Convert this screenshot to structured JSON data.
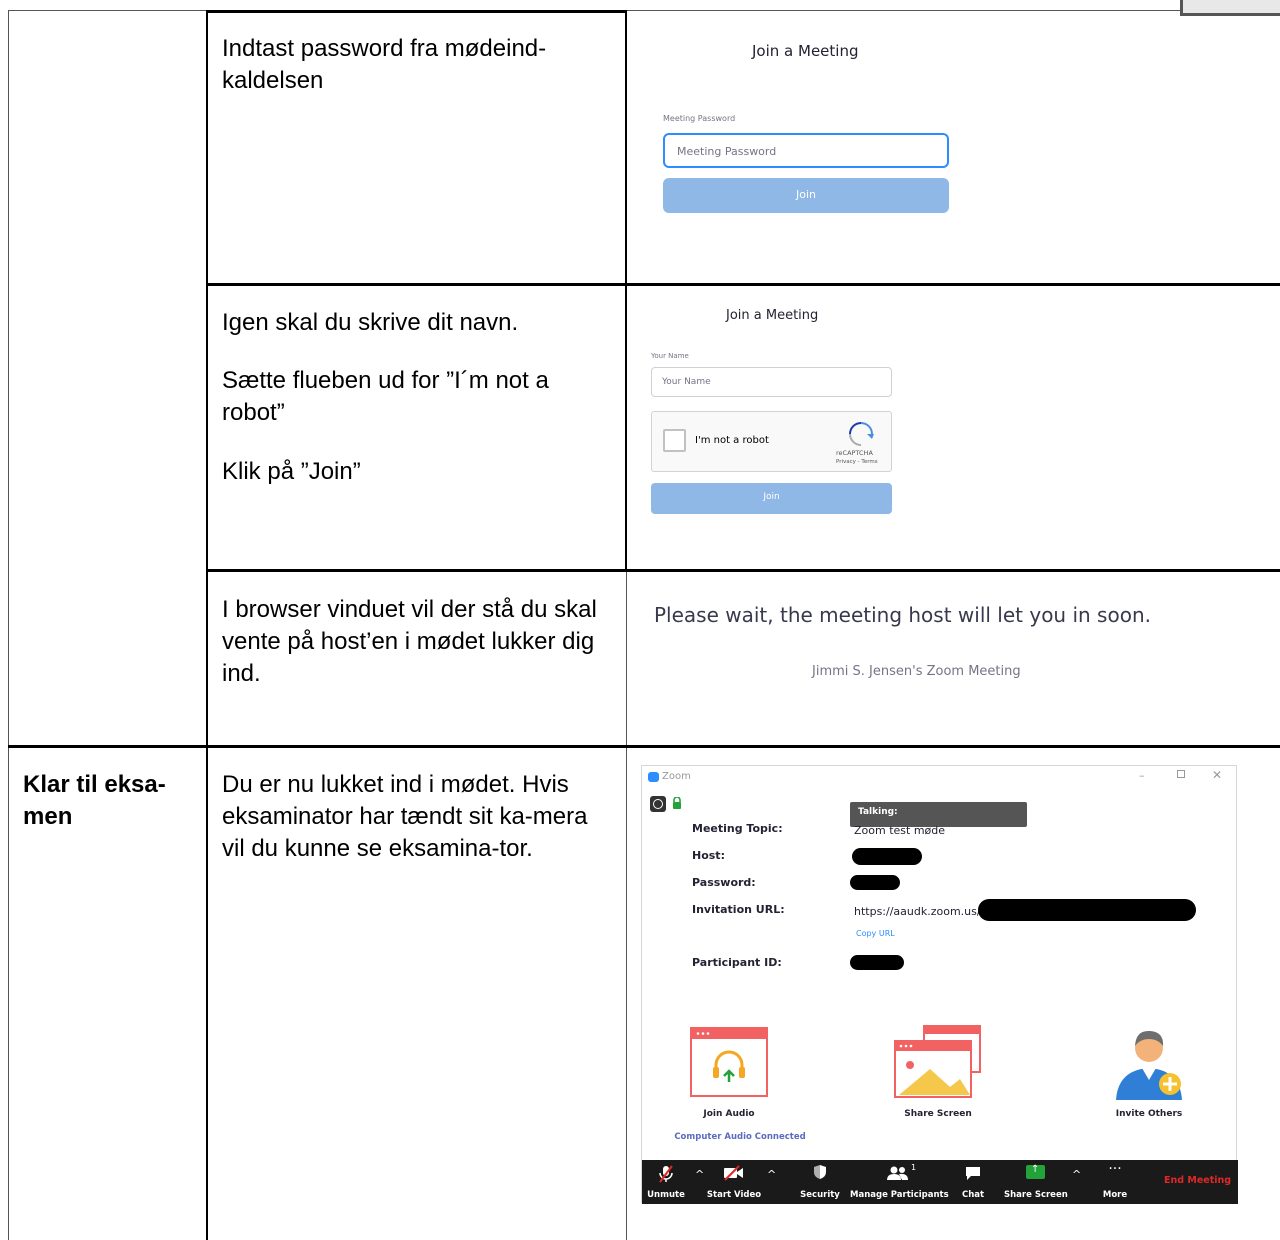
{
  "rows": [
    {
      "step_label": "",
      "instruction": [
        "Indtast password fra mødeind-",
        "kaldelsen"
      ],
      "screenshot": {
        "title": "Join a Meeting",
        "field_label": "Meeting Password",
        "field_placeholder": "Meeting Password",
        "button": "Join"
      }
    },
    {
      "step_label": "",
      "instruction_paragraphs": [
        "Igen skal du skrive dit navn.",
        "Sætte flueben ud for ”I´m not a robot”",
        "Klik på ”Join”"
      ],
      "screenshot": {
        "title": "Join a Meeting",
        "field_label": "Your Name",
        "field_placeholder": "Your Name",
        "captcha_text": "I'm not a robot",
        "captcha_brand": "reCAPTCHA",
        "captcha_links": "Privacy - Terms",
        "button": "Join"
      }
    },
    {
      "step_label": "",
      "instruction": "I browser vinduet vil der stå du skal vente på host’en i mødet lukker dig ind.",
      "screenshot": {
        "message": "Please wait, the meeting host will let you in soon.",
        "meeting_name": "Jimmi S. Jensen's Zoom Meeting"
      }
    },
    {
      "step_label": "Klar til eksa-men",
      "instruction": "Du er nu lukket ind i mødet. Hvis eksaminator har tændt sit ka-mera vil du kunne se eksamina-tor.",
      "screenshot": {
        "app_title": "Zoom",
        "talking_label": "Talking:",
        "fields": [
          {
            "label": "Meeting Topic:",
            "value": "Zoom test møde"
          },
          {
            "label": "Host:",
            "value": ""
          },
          {
            "label": "Password:",
            "value": ""
          },
          {
            "label": "Invitation URL:",
            "value": "https://aaudk.zoom.us/"
          },
          {
            "label": "Participant ID:",
            "value": ""
          }
        ],
        "copy_url": "Copy URL",
        "actions": [
          "Join Audio",
          "Share Screen",
          "Invite Others"
        ],
        "audio_status": "Computer Audio Connected",
        "toolbar": {
          "unmute": "Unmute",
          "start_video": "Start Video",
          "security": "Security",
          "manage_participants": "Manage Participants",
          "participant_count": "1",
          "chat": "Chat",
          "share_screen": "Share Screen",
          "more": "More",
          "end_meeting": "End Meeting"
        }
      }
    }
  ]
}
